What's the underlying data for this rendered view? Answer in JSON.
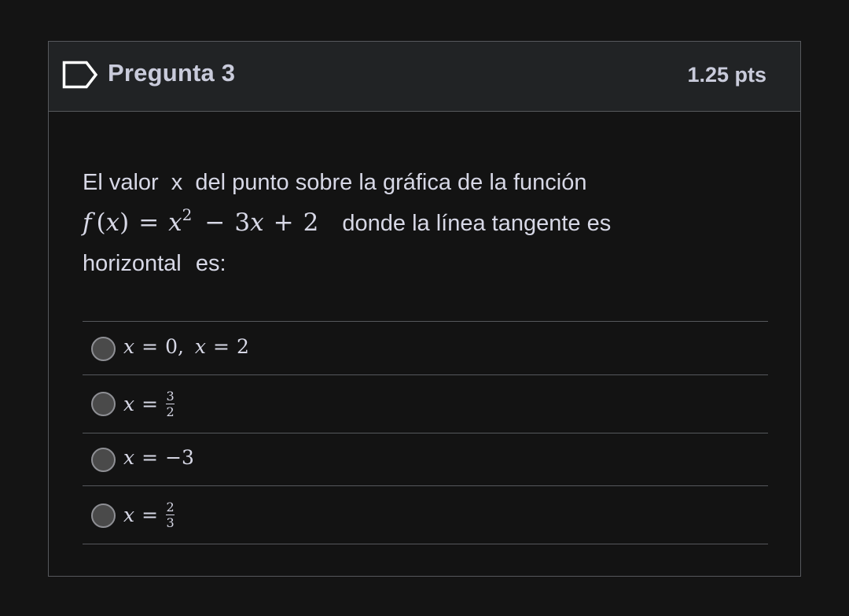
{
  "question": {
    "title": "Pregunta 3",
    "points": "1.25 pts",
    "text_part1": "El valor",
    "var_x": "x",
    "text_part2": "del punto sobre la gráfica de la función",
    "formula": {
      "f": "f",
      "lhs_open": "(",
      "lhs_var": "x",
      "lhs_close": ")",
      "eq": "=",
      "x": "x",
      "exp": "2",
      "minus": "−",
      "coef": "3",
      "x2": "x",
      "plus": "+",
      "const": "2"
    },
    "text_part3": "donde la línea tangente es",
    "text_part4": "horizontal",
    "text_part5": "es:"
  },
  "answers": [
    {
      "var": "x",
      "eq": "=",
      "val": "0,",
      "var2": "x",
      "eq2": "=",
      "val2": "2"
    },
    {
      "var": "x",
      "eq": "=",
      "num": "3",
      "den": "2"
    },
    {
      "var": "x",
      "eq": "=",
      "val": "−3"
    },
    {
      "var": "x",
      "eq": "=",
      "num": "2",
      "den": "3"
    }
  ],
  "colors": {
    "background": "#141414",
    "header": "#212325",
    "border": "#56585c",
    "text": "#d7d8e6",
    "radio": "#4a4a4a"
  },
  "icons": {
    "flag": "flag-outline-icon"
  }
}
